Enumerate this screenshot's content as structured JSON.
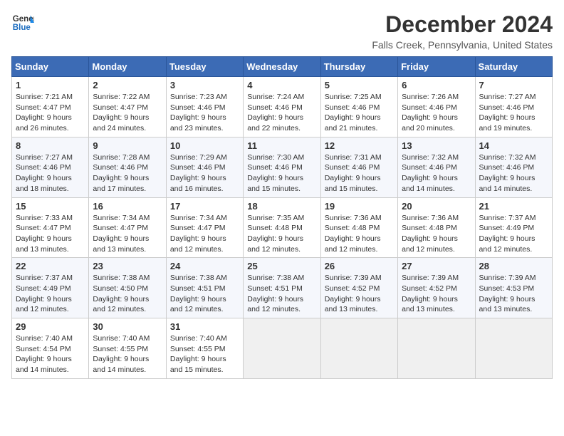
{
  "header": {
    "logo_line1": "General",
    "logo_line2": "Blue",
    "month_title": "December 2024",
    "location": "Falls Creek, Pennsylvania, United States"
  },
  "weekdays": [
    "Sunday",
    "Monday",
    "Tuesday",
    "Wednesday",
    "Thursday",
    "Friday",
    "Saturday"
  ],
  "weeks": [
    [
      {
        "day": "1",
        "sunrise": "Sunrise: 7:21 AM",
        "sunset": "Sunset: 4:47 PM",
        "daylight": "Daylight: 9 hours and 26 minutes."
      },
      {
        "day": "2",
        "sunrise": "Sunrise: 7:22 AM",
        "sunset": "Sunset: 4:47 PM",
        "daylight": "Daylight: 9 hours and 24 minutes."
      },
      {
        "day": "3",
        "sunrise": "Sunrise: 7:23 AM",
        "sunset": "Sunset: 4:46 PM",
        "daylight": "Daylight: 9 hours and 23 minutes."
      },
      {
        "day": "4",
        "sunrise": "Sunrise: 7:24 AM",
        "sunset": "Sunset: 4:46 PM",
        "daylight": "Daylight: 9 hours and 22 minutes."
      },
      {
        "day": "5",
        "sunrise": "Sunrise: 7:25 AM",
        "sunset": "Sunset: 4:46 PM",
        "daylight": "Daylight: 9 hours and 21 minutes."
      },
      {
        "day": "6",
        "sunrise": "Sunrise: 7:26 AM",
        "sunset": "Sunset: 4:46 PM",
        "daylight": "Daylight: 9 hours and 20 minutes."
      },
      {
        "day": "7",
        "sunrise": "Sunrise: 7:27 AM",
        "sunset": "Sunset: 4:46 PM",
        "daylight": "Daylight: 9 hours and 19 minutes."
      }
    ],
    [
      {
        "day": "8",
        "sunrise": "Sunrise: 7:27 AM",
        "sunset": "Sunset: 4:46 PM",
        "daylight": "Daylight: 9 hours and 18 minutes."
      },
      {
        "day": "9",
        "sunrise": "Sunrise: 7:28 AM",
        "sunset": "Sunset: 4:46 PM",
        "daylight": "Daylight: 9 hours and 17 minutes."
      },
      {
        "day": "10",
        "sunrise": "Sunrise: 7:29 AM",
        "sunset": "Sunset: 4:46 PM",
        "daylight": "Daylight: 9 hours and 16 minutes."
      },
      {
        "day": "11",
        "sunrise": "Sunrise: 7:30 AM",
        "sunset": "Sunset: 4:46 PM",
        "daylight": "Daylight: 9 hours and 15 minutes."
      },
      {
        "day": "12",
        "sunrise": "Sunrise: 7:31 AM",
        "sunset": "Sunset: 4:46 PM",
        "daylight": "Daylight: 9 hours and 15 minutes."
      },
      {
        "day": "13",
        "sunrise": "Sunrise: 7:32 AM",
        "sunset": "Sunset: 4:46 PM",
        "daylight": "Daylight: 9 hours and 14 minutes."
      },
      {
        "day": "14",
        "sunrise": "Sunrise: 7:32 AM",
        "sunset": "Sunset: 4:46 PM",
        "daylight": "Daylight: 9 hours and 14 minutes."
      }
    ],
    [
      {
        "day": "15",
        "sunrise": "Sunrise: 7:33 AM",
        "sunset": "Sunset: 4:47 PM",
        "daylight": "Daylight: 9 hours and 13 minutes."
      },
      {
        "day": "16",
        "sunrise": "Sunrise: 7:34 AM",
        "sunset": "Sunset: 4:47 PM",
        "daylight": "Daylight: 9 hours and 13 minutes."
      },
      {
        "day": "17",
        "sunrise": "Sunrise: 7:34 AM",
        "sunset": "Sunset: 4:47 PM",
        "daylight": "Daylight: 9 hours and 12 minutes."
      },
      {
        "day": "18",
        "sunrise": "Sunrise: 7:35 AM",
        "sunset": "Sunset: 4:48 PM",
        "daylight": "Daylight: 9 hours and 12 minutes."
      },
      {
        "day": "19",
        "sunrise": "Sunrise: 7:36 AM",
        "sunset": "Sunset: 4:48 PM",
        "daylight": "Daylight: 9 hours and 12 minutes."
      },
      {
        "day": "20",
        "sunrise": "Sunrise: 7:36 AM",
        "sunset": "Sunset: 4:48 PM",
        "daylight": "Daylight: 9 hours and 12 minutes."
      },
      {
        "day": "21",
        "sunrise": "Sunrise: 7:37 AM",
        "sunset": "Sunset: 4:49 PM",
        "daylight": "Daylight: 9 hours and 12 minutes."
      }
    ],
    [
      {
        "day": "22",
        "sunrise": "Sunrise: 7:37 AM",
        "sunset": "Sunset: 4:49 PM",
        "daylight": "Daylight: 9 hours and 12 minutes."
      },
      {
        "day": "23",
        "sunrise": "Sunrise: 7:38 AM",
        "sunset": "Sunset: 4:50 PM",
        "daylight": "Daylight: 9 hours and 12 minutes."
      },
      {
        "day": "24",
        "sunrise": "Sunrise: 7:38 AM",
        "sunset": "Sunset: 4:51 PM",
        "daylight": "Daylight: 9 hours and 12 minutes."
      },
      {
        "day": "25",
        "sunrise": "Sunrise: 7:38 AM",
        "sunset": "Sunset: 4:51 PM",
        "daylight": "Daylight: 9 hours and 12 minutes."
      },
      {
        "day": "26",
        "sunrise": "Sunrise: 7:39 AM",
        "sunset": "Sunset: 4:52 PM",
        "daylight": "Daylight: 9 hours and 13 minutes."
      },
      {
        "day": "27",
        "sunrise": "Sunrise: 7:39 AM",
        "sunset": "Sunset: 4:52 PM",
        "daylight": "Daylight: 9 hours and 13 minutes."
      },
      {
        "day": "28",
        "sunrise": "Sunrise: 7:39 AM",
        "sunset": "Sunset: 4:53 PM",
        "daylight": "Daylight: 9 hours and 13 minutes."
      }
    ],
    [
      {
        "day": "29",
        "sunrise": "Sunrise: 7:40 AM",
        "sunset": "Sunset: 4:54 PM",
        "daylight": "Daylight: 9 hours and 14 minutes."
      },
      {
        "day": "30",
        "sunrise": "Sunrise: 7:40 AM",
        "sunset": "Sunset: 4:55 PM",
        "daylight": "Daylight: 9 hours and 14 minutes."
      },
      {
        "day": "31",
        "sunrise": "Sunrise: 7:40 AM",
        "sunset": "Sunset: 4:55 PM",
        "daylight": "Daylight: 9 hours and 15 minutes."
      },
      null,
      null,
      null,
      null
    ]
  ]
}
